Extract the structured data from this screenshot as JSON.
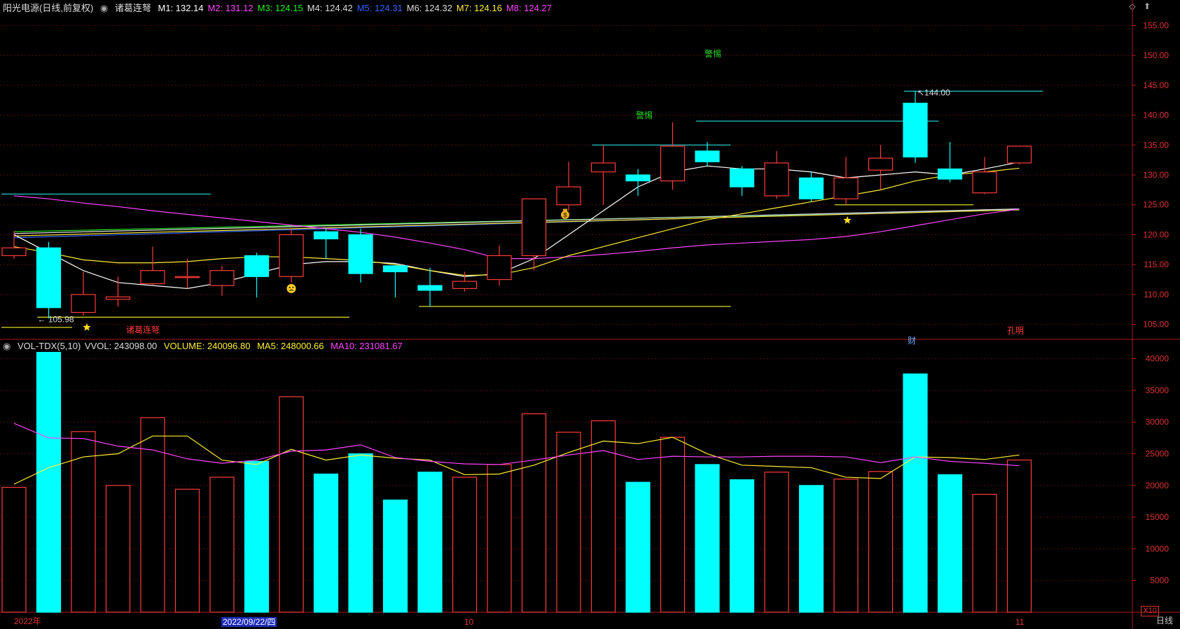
{
  "header": {
    "title": "阳光电源(日线,前复权)",
    "formula": "诸葛连弩",
    "ma_labels": [
      {
        "key": "M1",
        "value": "132.14",
        "color": "#ffffff"
      },
      {
        "key": "M2",
        "value": "131.12",
        "color": "#ff44ff"
      },
      {
        "key": "M3",
        "value": "124.15",
        "color": "#22ee22"
      },
      {
        "key": "M4",
        "value": "124.42",
        "color": "#dddddd"
      },
      {
        "key": "M5",
        "value": "124.31",
        "color": "#3366ff"
      },
      {
        "key": "M6",
        "value": "124.32",
        "color": "#dddddd"
      },
      {
        "key": "M7",
        "value": "124.16",
        "color": "#ffee33"
      },
      {
        "key": "M8",
        "value": "124.27",
        "color": "#ff44ff"
      }
    ]
  },
  "volume_header": {
    "name": "VOL-TDX(5,10)",
    "vvol": "VVOL: 243098.00",
    "volume": "VOLUME: 240096.80",
    "ma5": "MA5: 248000.66",
    "ma10": "MA10: 231081.67"
  },
  "annotations": {
    "low_price": "105.98",
    "high_price": "144.00",
    "zhuge": "诸葛连弩",
    "jingti1": "警惕",
    "jingti2": "警惕",
    "cai": "财",
    "kongming": "孔明"
  },
  "x_axis": {
    "year_label": "2022年",
    "selected_date": "2022/09/22/四",
    "month_oct": "10",
    "month_nov": "11",
    "period": "日线",
    "unit": "X10"
  },
  "colors": {
    "up": "#ff3b3b",
    "down": "#00ffff",
    "axis": "#b01818",
    "grid": "#5a0c0c"
  },
  "chart_data": [
    {
      "type": "candlestick",
      "ylim": [
        102.5,
        157.5
      ],
      "y_ticks": [
        105,
        110,
        115,
        120,
        125,
        130,
        135,
        140,
        145,
        150,
        155
      ],
      "candles": [
        {
          "open": 116.5,
          "high": 120.6,
          "low": 116.0,
          "close": 117.8
        },
        {
          "open": 117.8,
          "high": 118.8,
          "low": 105.98,
          "close": 107.8
        },
        {
          "open": 107.0,
          "high": 113.8,
          "low": 106.5,
          "close": 110.0
        },
        {
          "open": 109.2,
          "high": 113.0,
          "low": 108.0,
          "close": 109.6
        },
        {
          "open": 111.8,
          "high": 118.0,
          "low": 111.5,
          "close": 114.0
        },
        {
          "open": 113.0,
          "high": 116.0,
          "low": 111.0,
          "close": 113.0
        },
        {
          "open": 111.5,
          "high": 114.8,
          "low": 109.8,
          "close": 114.0
        },
        {
          "open": 116.5,
          "high": 117.0,
          "low": 109.5,
          "close": 113.0
        },
        {
          "open": 113.0,
          "high": 121.0,
          "low": 112.0,
          "close": 120.0
        },
        {
          "open": 120.5,
          "high": 121.2,
          "low": 116.0,
          "close": 119.3
        },
        {
          "open": 120.0,
          "high": 121.0,
          "low": 112.0,
          "close": 113.5
        },
        {
          "open": 114.8,
          "high": 115.0,
          "low": 109.5,
          "close": 113.8
        },
        {
          "open": 111.5,
          "high": 114.5,
          "low": 108.0,
          "close": 110.7
        },
        {
          "open": 111.0,
          "high": 113.8,
          "low": 110.5,
          "close": 112.2
        },
        {
          "open": 112.5,
          "high": 118.2,
          "low": 111.5,
          "close": 116.5
        },
        {
          "open": 116.5,
          "high": 126.0,
          "low": 114.0,
          "close": 126.0
        },
        {
          "open": 125.0,
          "high": 132.2,
          "low": 124.0,
          "close": 128.0
        },
        {
          "open": 130.5,
          "high": 135.0,
          "low": 125.0,
          "close": 132.0
        },
        {
          "open": 130.0,
          "high": 131.0,
          "low": 126.5,
          "close": 129.0
        },
        {
          "open": 129.0,
          "high": 138.8,
          "low": 127.5,
          "close": 134.8
        },
        {
          "open": 134.0,
          "high": 135.5,
          "low": 131.5,
          "close": 132.2
        },
        {
          "open": 131.0,
          "high": 131.5,
          "low": 126.5,
          "close": 128.0
        },
        {
          "open": 126.5,
          "high": 134.0,
          "low": 126.0,
          "close": 132.0
        },
        {
          "open": 129.5,
          "high": 130.5,
          "low": 125.5,
          "close": 126.0
        },
        {
          "open": 126.0,
          "high": 133.0,
          "low": 125.0,
          "close": 129.5
        },
        {
          "open": 130.8,
          "high": 135.0,
          "low": 127.5,
          "close": 132.8
        },
        {
          "open": 142.0,
          "high": 144.0,
          "low": 132.0,
          "close": 133.0
        },
        {
          "open": 131.0,
          "high": 135.5,
          "low": 128.8,
          "close": 129.3
        },
        {
          "open": 127.0,
          "high": 133.0,
          "low": 126.8,
          "close": 130.5
        },
        {
          "open": 132.0,
          "high": 134.8,
          "low": 131.8,
          "close": 134.8
        }
      ],
      "ma_lines": [
        {
          "name": "M1",
          "color": "#ffffff",
          "values": [
            120,
            117,
            114,
            112,
            111.5,
            111,
            112,
            113.5,
            115,
            115.5,
            115.5,
            115.2,
            114,
            113,
            113.5,
            116,
            120,
            124,
            128,
            130.5,
            131.5,
            131,
            131,
            130.5,
            129.5,
            130,
            130.5,
            130,
            131,
            132.14
          ]
        },
        {
          "name": "M2",
          "color": "#ff44ff",
          "values": [
            126.5,
            126,
            125.3,
            124.7,
            124,
            123.4,
            122.8,
            122.2,
            121.6,
            121,
            120.4,
            119.6,
            118.6,
            117.5,
            116,
            116,
            116.3,
            116.7,
            117.2,
            117.8,
            118.3,
            118.6,
            118.9,
            119.2,
            119.7,
            120.5,
            121.5,
            122.5,
            123.5,
            124.27
          ]
        },
        {
          "name": "M3",
          "color": "#ffee33",
          "values": [
            118,
            117,
            115.8,
            115.3,
            115.3,
            115.5,
            116,
            116.3,
            116.3,
            116,
            115.7,
            115,
            114,
            113.2,
            113.3,
            114.5,
            116.5,
            118,
            119.5,
            121,
            122.5,
            123.5,
            124.5,
            125.5,
            126.5,
            127.5,
            129,
            130,
            130.5,
            131.12
          ]
        }
      ],
      "flat_ma_bundle": [
        {
          "color": "#22ee22",
          "values": [
            120.5,
            124.15
          ]
        },
        {
          "color": "#3366ff",
          "values": [
            119.5,
            124.31
          ]
        },
        {
          "color": "#dddddd",
          "values": [
            120.2,
            124.32
          ]
        },
        {
          "color": "#ffee33",
          "values": [
            119.8,
            124.16
          ]
        }
      ],
      "hlines": [
        {
          "color": "#22c8c8",
          "y": 126.8,
          "from": 0,
          "to": 6
        },
        {
          "color": "#22c8c8",
          "y": 135.0,
          "from": 17,
          "to": 21
        },
        {
          "color": "#22c8c8",
          "y": 139.0,
          "from": 20,
          "to": 27
        },
        {
          "color": "#22c8c8",
          "y": 144.0,
          "from": 26,
          "to": 30
        },
        {
          "color": "#dddd22",
          "y": 106.2,
          "from": 1,
          "to": 10
        },
        {
          "color": "#dddd22",
          "y": 104.5,
          "from": 0,
          "to": 2
        },
        {
          "color": "#dddd22",
          "y": 108.0,
          "from": 12,
          "to": 21
        },
        {
          "color": "#dddd22",
          "y": 125.0,
          "from": 24,
          "to": 28
        }
      ]
    },
    {
      "type": "bar",
      "ylim": [
        0,
        42500
      ],
      "y_ticks": [
        5000,
        10000,
        15000,
        20000,
        25000,
        30000,
        35000,
        40000
      ],
      "values": [
        19700,
        41000,
        28500,
        20000,
        30700,
        19400,
        21300,
        23800,
        34000,
        21800,
        25000,
        17700,
        22100,
        21300,
        23300,
        31300,
        28400,
        30200,
        20500,
        27600,
        23300,
        20900,
        22100,
        20000,
        21000,
        22200,
        37600,
        21700,
        18600,
        24009.6
      ],
      "ma5": [
        20200,
        22800,
        24500,
        25000,
        27800,
        27800,
        24000,
        23300,
        25700,
        24000,
        24800,
        24300,
        24000,
        21700,
        21800,
        23200,
        25200,
        27000,
        26600,
        27600,
        25000,
        23200,
        23000,
        22800,
        21300,
        21100,
        24500,
        24400,
        24100,
        24800
      ],
      "ma10": [
        29800,
        27500,
        27400,
        26200,
        25600,
        24200,
        23500,
        24000,
        25400,
        25600,
        26400,
        24400,
        23800,
        23400,
        23300,
        24000,
        24800,
        25500,
        24100,
        24600,
        24500,
        24500,
        24600,
        24600,
        24500,
        23600,
        24500,
        23800,
        23500,
        23108.167
      ]
    }
  ]
}
